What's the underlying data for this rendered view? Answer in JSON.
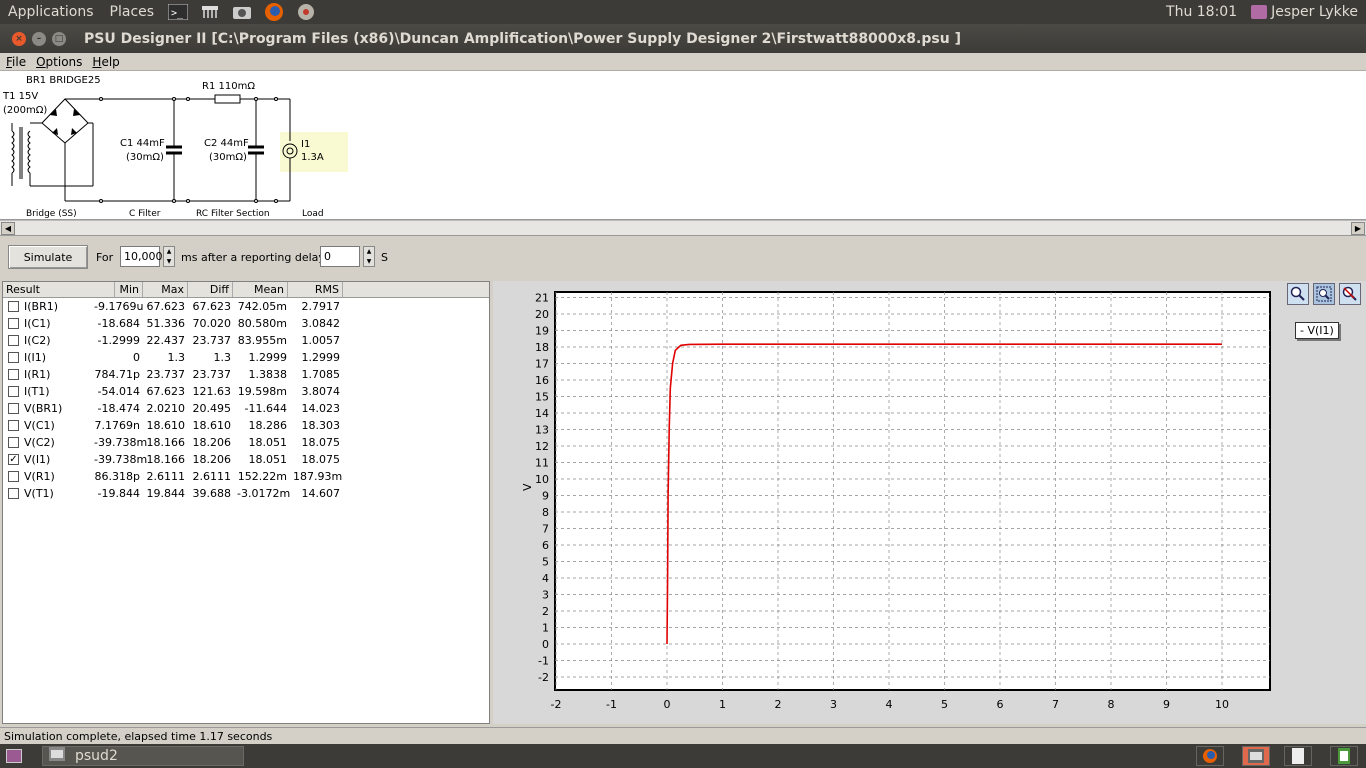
{
  "top_panel": {
    "applications": "Applications",
    "places": "Places",
    "clock": "Thu 18:01",
    "user": "Jesper Lykke"
  },
  "window": {
    "title": "PSU Designer II  [C:\\Program Files (x86)\\Duncan Amplification\\Power Supply Designer 2\\Firstwatt88000x8.psu ]"
  },
  "menu": {
    "file": "File",
    "options": "Options",
    "help": "Help"
  },
  "schematic": {
    "t1_name": "T1 15V",
    "t1_res": "(200mΩ)",
    "br1": "BR1 BRIDGE25",
    "r1": "R1 110mΩ",
    "c1_name": "C1 44mF",
    "c1_res": "(30mΩ)",
    "c2_name": "C2 44mF",
    "c2_res": "(30mΩ)",
    "i1_name": "I1",
    "i1_val": "1.3A",
    "sec_bridge": "Bridge (SS)",
    "sec_cfilter": "C Filter",
    "sec_rc": "RC Filter Section",
    "sec_load": "Load"
  },
  "sim": {
    "button": "Simulate",
    "for_label": "For",
    "duration": "10,000",
    "ms_label": "ms",
    "delay_label": "after a reporting delay of",
    "delay": "0",
    "s_label": "S"
  },
  "results": {
    "columns": [
      "Result",
      "Min",
      "Max",
      "Diff",
      "Mean",
      "RMS"
    ],
    "rows": [
      {
        "name": "I(BR1)",
        "checked": false,
        "min": "-9.1769u",
        "max": "67.623",
        "diff": "67.623",
        "mean": "742.05m",
        "rms": "2.7917"
      },
      {
        "name": "I(C1)",
        "checked": false,
        "min": "-18.684",
        "max": "51.336",
        "diff": "70.020",
        "mean": "80.580m",
        "rms": "3.0842"
      },
      {
        "name": "I(C2)",
        "checked": false,
        "min": "-1.2999",
        "max": "22.437",
        "diff": "23.737",
        "mean": "83.955m",
        "rms": "1.0057"
      },
      {
        "name": "I(I1)",
        "checked": false,
        "min": "0",
        "max": "1.3",
        "diff": "1.3",
        "mean": "1.2999",
        "rms": "1.2999"
      },
      {
        "name": "I(R1)",
        "checked": false,
        "min": "784.71p",
        "max": "23.737",
        "diff": "23.737",
        "mean": "1.3838",
        "rms": "1.7085"
      },
      {
        "name": "I(T1)",
        "checked": false,
        "min": "-54.014",
        "max": "67.623",
        "diff": "121.63",
        "mean": "19.598m",
        "rms": "3.8074"
      },
      {
        "name": "V(BR1)",
        "checked": false,
        "min": "-18.474",
        "max": "2.0210",
        "diff": "20.495",
        "mean": "-11.644",
        "rms": "14.023"
      },
      {
        "name": "V(C1)",
        "checked": false,
        "min": "7.1769n",
        "max": "18.610",
        "diff": "18.610",
        "mean": "18.286",
        "rms": "18.303"
      },
      {
        "name": "V(C2)",
        "checked": false,
        "min": "-39.738m",
        "max": "18.166",
        "diff": "18.206",
        "mean": "18.051",
        "rms": "18.075"
      },
      {
        "name": "V(I1)",
        "checked": true,
        "min": "-39.738m",
        "max": "18.166",
        "diff": "18.206",
        "mean": "18.051",
        "rms": "18.075"
      },
      {
        "name": "V(R1)",
        "checked": false,
        "min": "86.318p",
        "max": "2.6111",
        "diff": "2.6111",
        "mean": "152.22m",
        "rms": "187.93m"
      },
      {
        "name": "V(T1)",
        "checked": false,
        "min": "-19.844",
        "max": "19.844",
        "diff": "39.688",
        "mean": "-3.0172m",
        "rms": "14.607"
      }
    ]
  },
  "chart_data": {
    "type": "line",
    "ylabel": "V",
    "xlim": [
      -2,
      10
    ],
    "ylim": [
      -2,
      21
    ],
    "x_ticks": [
      "-2",
      "-1",
      "0",
      "1",
      "2",
      "3",
      "4",
      "5",
      "6",
      "7",
      "8",
      "9",
      "10"
    ],
    "y_ticks": [
      "-2",
      "-1",
      "0",
      "1",
      "2",
      "3",
      "4",
      "5",
      "6",
      "7",
      "8",
      "9",
      "10",
      "11",
      "12",
      "13",
      "14",
      "15",
      "16",
      "17",
      "18",
      "19",
      "20",
      "21"
    ],
    "grid": true,
    "legend": "top-right",
    "series": [
      {
        "name": "V(I1)",
        "color": "#e00000",
        "points": [
          [
            0,
            0
          ],
          [
            0.01,
            4
          ],
          [
            0.02,
            9
          ],
          [
            0.04,
            13
          ],
          [
            0.06,
            15.5
          ],
          [
            0.1,
            17
          ],
          [
            0.15,
            17.8
          ],
          [
            0.25,
            18.1
          ],
          [
            0.4,
            18.16
          ],
          [
            1,
            18.17
          ],
          [
            10,
            18.17
          ]
        ]
      }
    ],
    "legend_label": "- V(I1)"
  },
  "status": "Simulation complete, elapsed time 1.17 seconds",
  "taskbar": {
    "task": "psud2"
  }
}
